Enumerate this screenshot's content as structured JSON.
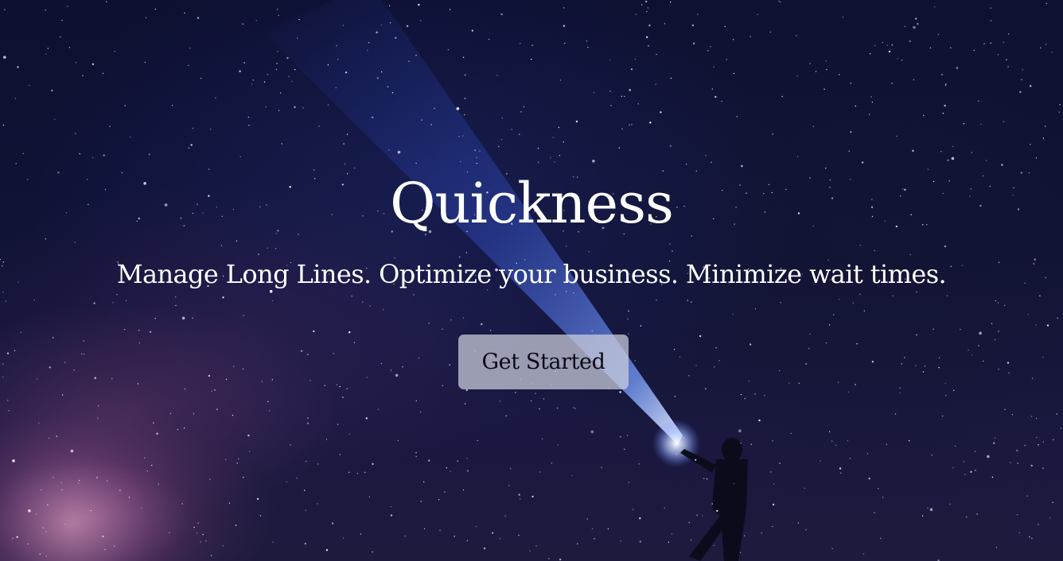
{
  "hero": {
    "title": "Quickness",
    "subtitle": "Manage Long Lines. Optimize your business. Minimize wait times.",
    "cta_label": "Get Started"
  },
  "background": {
    "description_icon": "night-sky-flashlight-photo",
    "colors": {
      "sky": "#0d1030",
      "beam": "#4f78ff",
      "milky_way": "#c878aa",
      "button_bg": "#cdd0de"
    }
  }
}
